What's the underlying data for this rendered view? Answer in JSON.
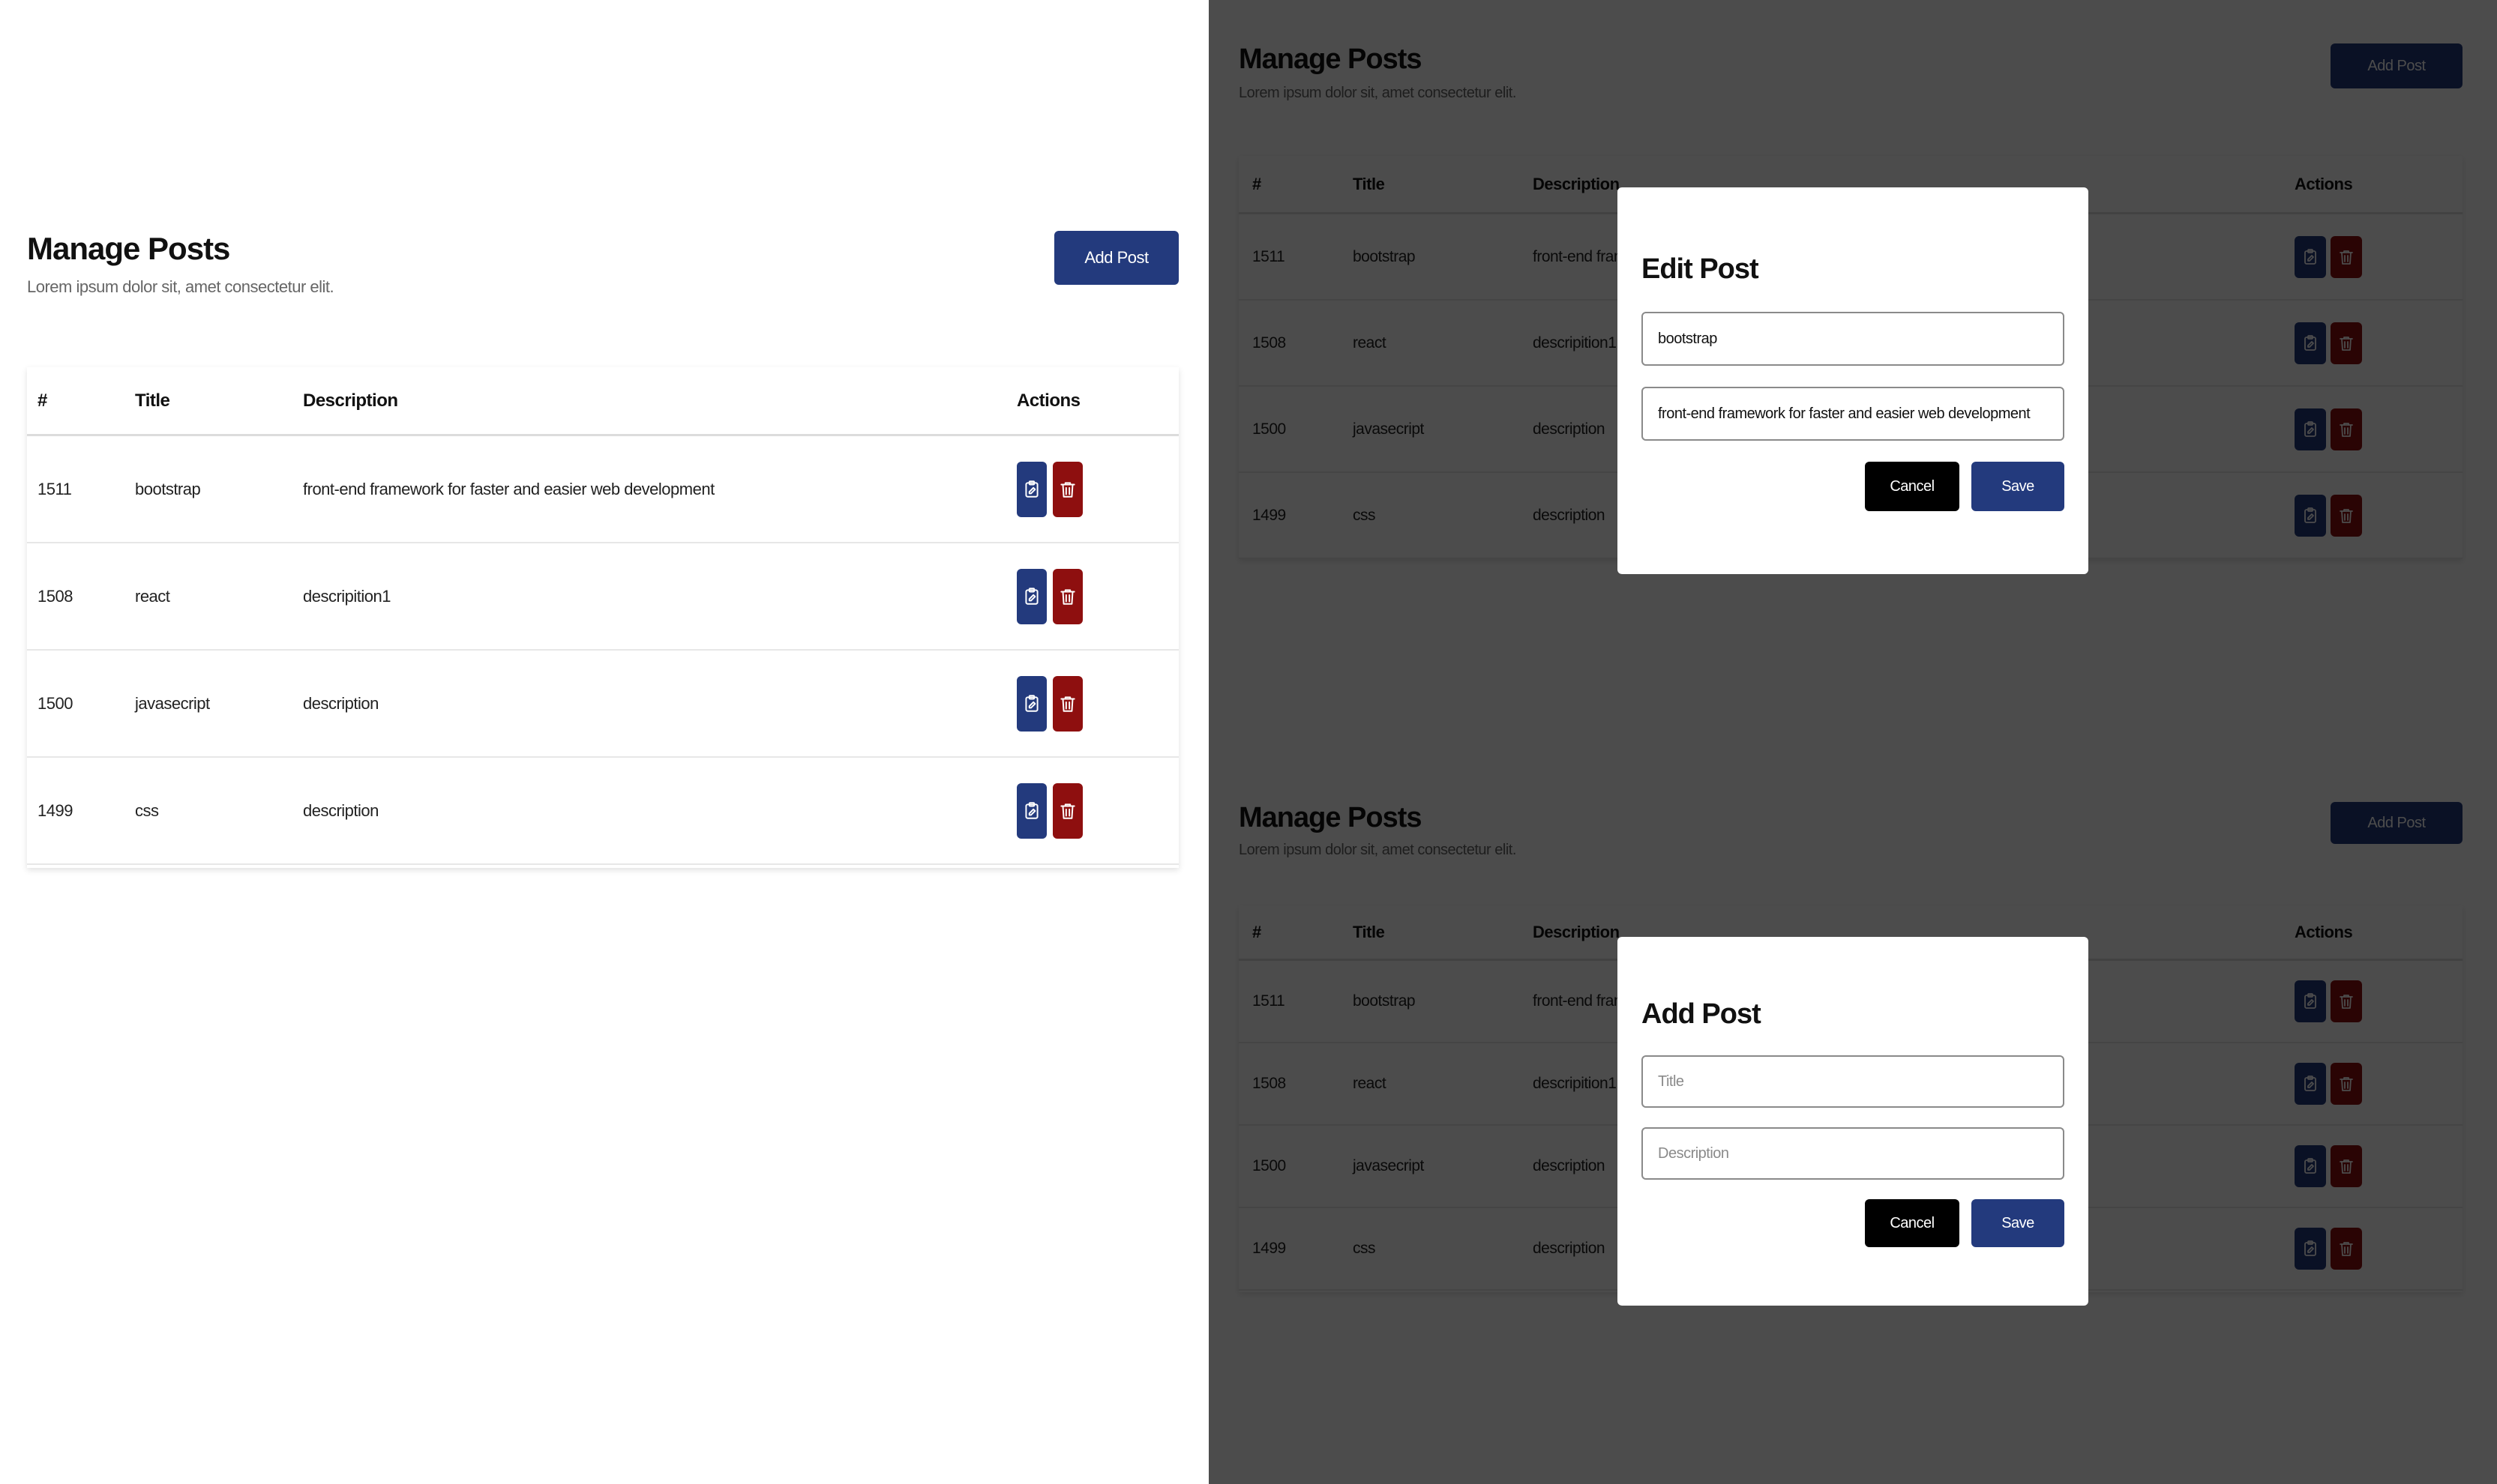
{
  "page": {
    "title": "Manage Posts",
    "subtitle": "Lorem ipsum dolor sit, amet consectetur elit.",
    "add_button_label": "Add Post"
  },
  "table": {
    "headers": {
      "id": "#",
      "title": "Title",
      "description": "Description",
      "actions": "Actions"
    },
    "rows": [
      {
        "id": "1511",
        "title": "bootstrap",
        "description": "front-end framework for faster and easier web development"
      },
      {
        "id": "1508",
        "title": "react",
        "description": "descripition1"
      },
      {
        "id": "1500",
        "title": "javasecript",
        "description": "description"
      },
      {
        "id": "1499",
        "title": "css",
        "description": "description"
      }
    ]
  },
  "edit_modal": {
    "title": "Edit Post",
    "title_value": "bootstrap",
    "description_value": "front-end framework for faster and easier web development",
    "cancel_label": "Cancel",
    "save_label": "Save"
  },
  "add_modal": {
    "title": "Add Post",
    "title_placeholder": "Title",
    "description_placeholder": "Description",
    "cancel_label": "Cancel",
    "save_label": "Save"
  },
  "icons": {
    "edit": "clipboard-edit-icon",
    "delete": "trash-icon"
  },
  "colors": {
    "primary": "#233a7d",
    "danger": "#8e0f0f",
    "overlay": "rgba(0,0,0,0.7)"
  }
}
